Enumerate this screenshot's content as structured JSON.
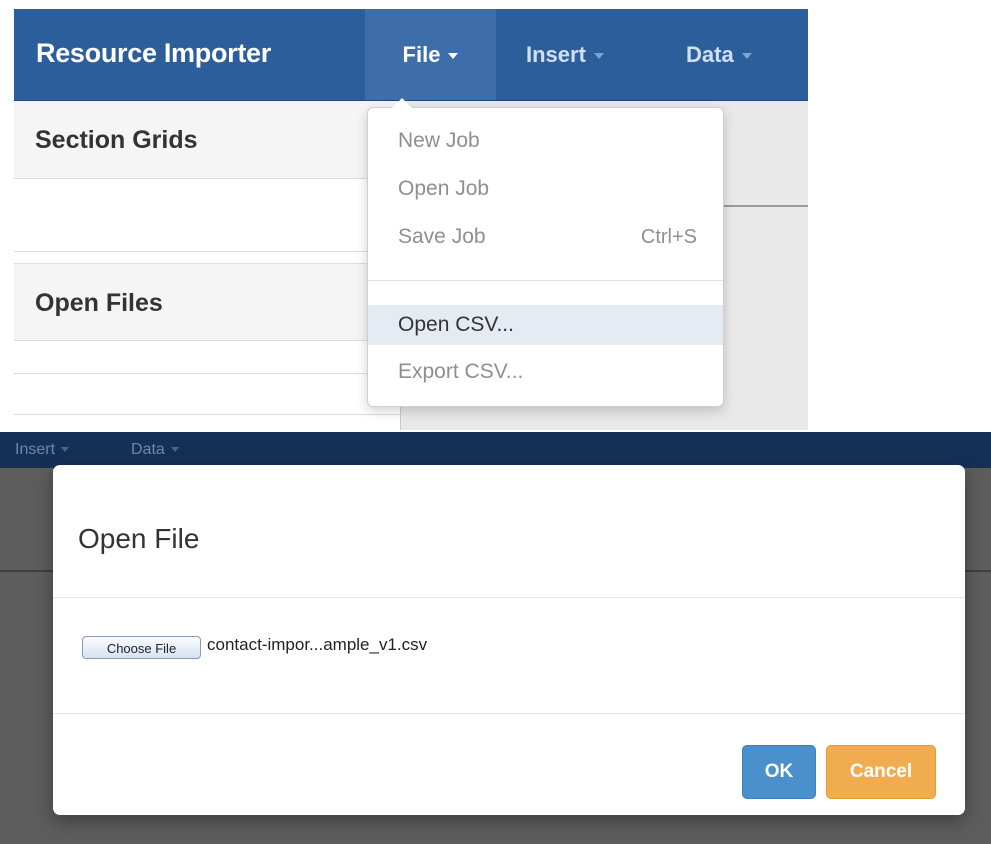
{
  "menu_screen": {
    "brand": "Resource Importer",
    "nav": {
      "file_label": "File",
      "insert_label": "Insert",
      "data_label": "Data"
    },
    "sidebar": {
      "section_grids": "Section Grids",
      "open_files": "Open Files"
    },
    "file_menu": {
      "items": [
        {
          "label": "New Job",
          "shortcut": "",
          "enabled": false
        },
        {
          "label": "Open Job",
          "shortcut": "",
          "enabled": false
        },
        {
          "label": "Save Job",
          "shortcut": "Ctrl+S",
          "enabled": false
        },
        {
          "label": "Open CSV...",
          "shortcut": "",
          "enabled": true,
          "highlighted": true
        },
        {
          "label": "Export CSV...",
          "shortcut": "",
          "enabled": false
        }
      ]
    }
  },
  "dialog_screen": {
    "nav": {
      "insert_label": "Insert",
      "data_label": "Data"
    },
    "dialog": {
      "title": "Open File",
      "choose_file_label": "Choose File",
      "selected_file": "contact-impor...ample_v1.csv",
      "ok_label": "OK",
      "cancel_label": "Cancel"
    }
  },
  "colors": {
    "navbar": "#2d5e9c",
    "navbar_active": "#3d6ea9",
    "menu_highlight": "#e5ebf3",
    "ok_button": "#4a90cd",
    "cancel_button": "#f0ac4e",
    "overlay": "#5d5d5d"
  }
}
